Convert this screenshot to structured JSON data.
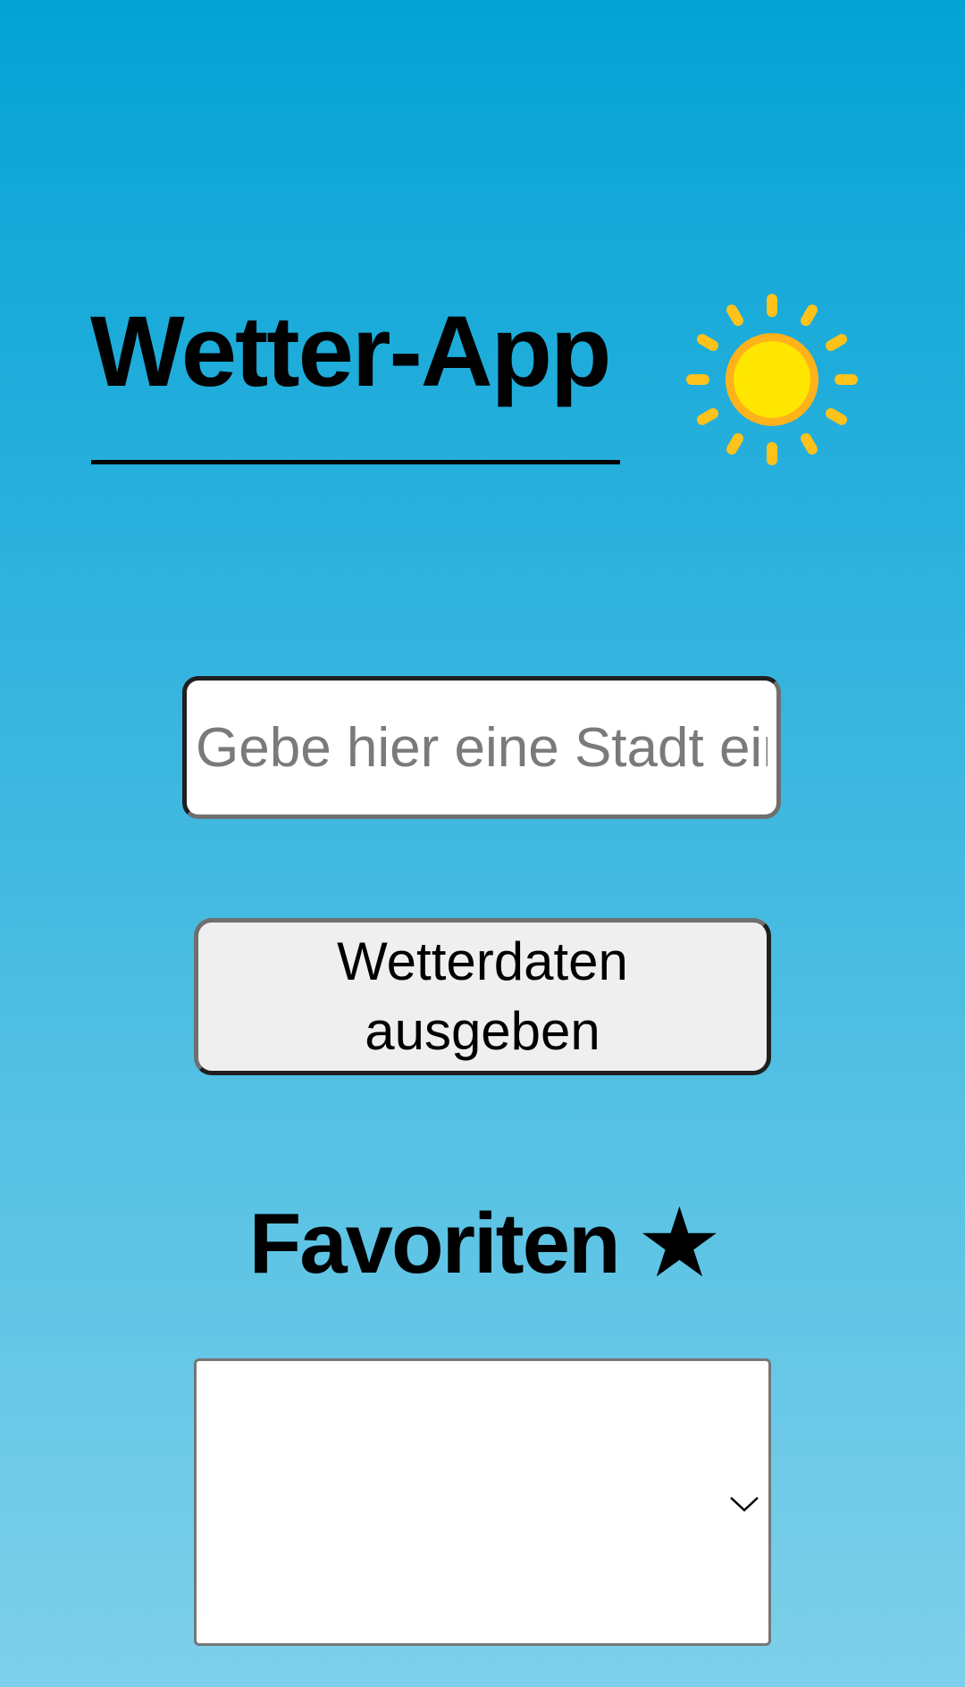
{
  "header": {
    "title": "Wetter-App",
    "icon": "sun-icon"
  },
  "search": {
    "placeholder": "Gebe hier eine Stadt ein",
    "value": ""
  },
  "submit": {
    "label": "Wetterdaten ausgeben"
  },
  "favorites": {
    "heading": "Favoriten ★",
    "selected": "",
    "icon": "chevron-down-icon"
  },
  "colors": {
    "background_top": "#04a3d5",
    "background_bottom": "#7ed0ea",
    "sun_core": "#ffe600",
    "sun_rays": "#ffc21a",
    "button_bg": "#efefef"
  }
}
